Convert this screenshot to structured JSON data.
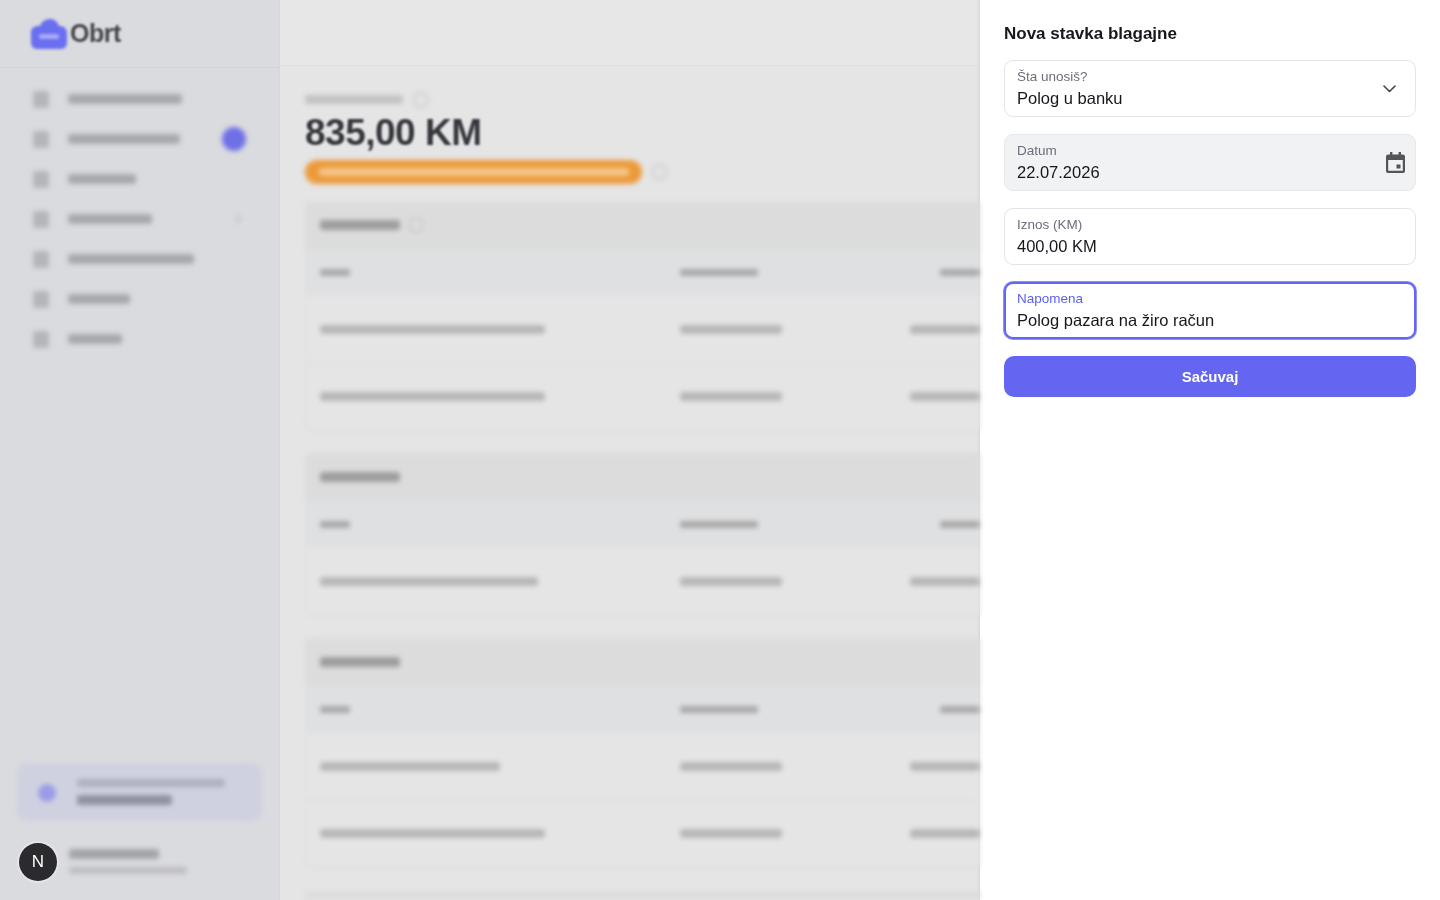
{
  "backdrop": {
    "logo_text": "Obrt",
    "balance": "835,00 KM",
    "avatar_letter": "N"
  },
  "panel": {
    "title": "Nova stavka blagajne",
    "fields": [
      {
        "kind": "select",
        "label": "Šta unosiš?",
        "value": "Polog u banku",
        "focused": false,
        "readonly": false
      },
      {
        "kind": "date",
        "label": "Datum",
        "value": "22.07.2026",
        "focused": false,
        "readonly": true
      },
      {
        "kind": "text",
        "label": "Iznos (KM)",
        "value": "400,00 KM",
        "focused": false,
        "readonly": false
      },
      {
        "kind": "text",
        "label": "Napomena",
        "value": "Polog pazara na žiro račun",
        "focused": true,
        "readonly": false
      }
    ],
    "submit": "Sačuvaj"
  }
}
